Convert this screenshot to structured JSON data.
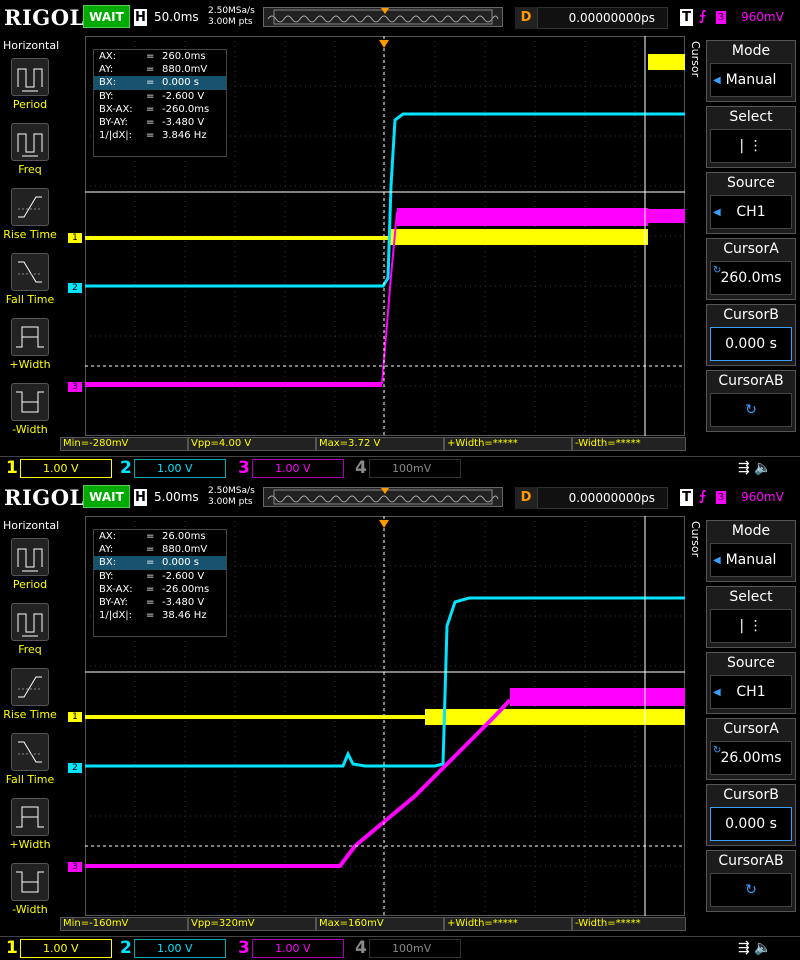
{
  "scopes": [
    {
      "top": {
        "logo": "RIGOL",
        "status": "WAIT",
        "h_label": "H",
        "timebase": "50.0ms",
        "sample_rate": "2.50MSa/s",
        "memory_depth": "3.00M pts",
        "d_label": "D",
        "delay": "0.00000000ps",
        "t_label": "T",
        "trigger_channel": "3",
        "trigger_level": "960mV"
      },
      "left": {
        "title": "Horizontal",
        "items": [
          "Period",
          "Freq",
          "Rise Time",
          "Fall Time",
          "+Width",
          "-Width"
        ]
      },
      "cursor_info": [
        {
          "k": "AX:",
          "v": "260.0ms"
        },
        {
          "k": "AY:",
          "v": "880.0mV"
        },
        {
          "k": "BX:",
          "v": "0.000 s"
        },
        {
          "k": "BY:",
          "v": "-2.600 V"
        },
        {
          "k": "BX-AX:",
          "v": "-260.0ms"
        },
        {
          "k": "BY-AY:",
          "v": "-3.480 V"
        },
        {
          "k": "1/|dX|:",
          "v": "3.846 Hz"
        }
      ],
      "right": {
        "vertical_label": "Cursor",
        "mode_title": "Mode",
        "mode_value": "Manual",
        "select_title": "Select",
        "select_value": "| ⋮",
        "source_title": "Source",
        "source_value": "CH1",
        "cursora_title": "CursorA",
        "cursora_value": "260.0ms",
        "cursorb_title": "CursorB",
        "cursorb_value": "0.000 s",
        "cursorab_title": "CursorAB"
      },
      "measurements": [
        "Min=-280mV",
        "Vpp=4.00 V",
        "Max=3.72 V",
        "+Width=*****",
        "-Width=*****"
      ],
      "channels": [
        {
          "num": "1",
          "scale": "1.00 V"
        },
        {
          "num": "2",
          "scale": "1.00 V"
        },
        {
          "num": "3",
          "scale": "1.00 V"
        },
        {
          "num": "4",
          "scale": "100mV"
        }
      ],
      "markers": {
        "ch1": "1",
        "ch2": "2",
        "ch3": "3",
        "trig": "T"
      }
    },
    {
      "top": {
        "logo": "RIGOL",
        "status": "WAIT",
        "h_label": "H",
        "timebase": "5.00ms",
        "sample_rate": "2.50MSa/s",
        "memory_depth": "3.00M pts",
        "d_label": "D",
        "delay": "0.00000000ps",
        "t_label": "T",
        "trigger_channel": "3",
        "trigger_level": "960mV"
      },
      "left": {
        "title": "Horizontal",
        "items": [
          "Period",
          "Freq",
          "Rise Time",
          "Fall Time",
          "+Width",
          "-Width"
        ]
      },
      "cursor_info": [
        {
          "k": "AX:",
          "v": "26.00ms"
        },
        {
          "k": "AY:",
          "v": "880.0mV"
        },
        {
          "k": "BX:",
          "v": "0.000 s"
        },
        {
          "k": "BY:",
          "v": "-2.600 V"
        },
        {
          "k": "BX-AX:",
          "v": "-26.00ms"
        },
        {
          "k": "BY-AY:",
          "v": "-3.480 V"
        },
        {
          "k": "1/|dX|:",
          "v": "38.46 Hz"
        }
      ],
      "right": {
        "vertical_label": "Cursor",
        "mode_title": "Mode",
        "mode_value": "Manual",
        "select_title": "Select",
        "select_value": "| ⋮",
        "source_title": "Source",
        "source_value": "CH1",
        "cursora_title": "CursorA",
        "cursora_value": "26.00ms",
        "cursorb_title": "CursorB",
        "cursorb_value": "0.000 s",
        "cursorab_title": "CursorAB"
      },
      "measurements": [
        "Min=-160mV",
        "Vpp=320mV",
        "Max=160mV",
        "+Width=*****",
        "-Width=*****"
      ],
      "channels": [
        {
          "num": "1",
          "scale": "1.00 V"
        },
        {
          "num": "2",
          "scale": "1.00 V"
        },
        {
          "num": "3",
          "scale": "1.00 V"
        },
        {
          "num": "4",
          "scale": "100mV"
        }
      ],
      "markers": {
        "ch1": "1",
        "ch2": "2",
        "ch3": "3",
        "trig": "T"
      }
    }
  ],
  "colors": {
    "ch1": "#ffff00",
    "ch2": "#00e5ff",
    "ch3": "#ff00ff",
    "ch4": "#5577ff",
    "trigger": "#ff9900",
    "status_bg": "#00aa00",
    "cursor_highlight": "#17536f"
  }
}
